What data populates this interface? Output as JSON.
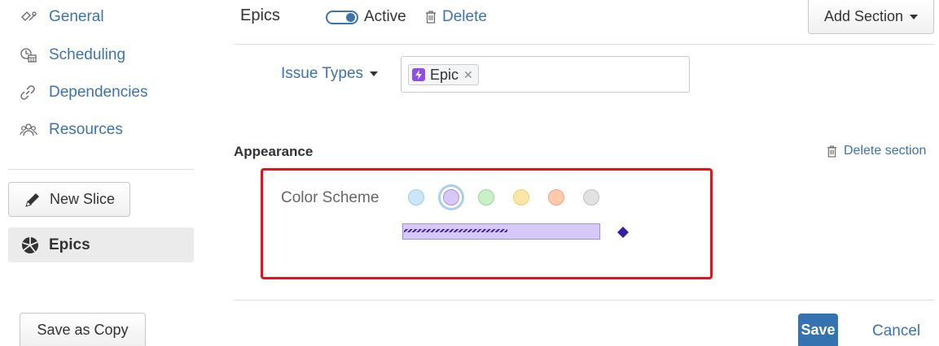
{
  "sidebar": {
    "items": [
      {
        "label": "General",
        "icon": "general-icon"
      },
      {
        "label": "Scheduling",
        "icon": "scheduling-icon"
      },
      {
        "label": "Dependencies",
        "icon": "link-icon"
      },
      {
        "label": "Resources",
        "icon": "people-icon"
      }
    ],
    "new_slice_label": "New Slice",
    "slices": [
      {
        "label": "Epics",
        "icon": "pie-chart-icon",
        "selected": true
      }
    ],
    "save_as_copy_label": "Save as Copy"
  },
  "header": {
    "title": "Epics",
    "active_label": "Active",
    "active": true,
    "delete_label": "Delete",
    "add_section_label": "Add Section"
  },
  "issue_types": {
    "label": "Issue Types",
    "tags": [
      {
        "label": "Epic",
        "icon": "epic-lightning-icon",
        "color": "#904ee2"
      }
    ]
  },
  "appearance": {
    "heading": "Appearance",
    "delete_section_label": "Delete section",
    "color_scheme_label": "Color Scheme",
    "colors": [
      {
        "name": "blue",
        "fill": "#cce5fb",
        "border": "#9fccf2"
      },
      {
        "name": "purple",
        "fill": "#d6c9f7",
        "border": "#a58ce8",
        "selected": true
      },
      {
        "name": "green",
        "fill": "#c9f0c9",
        "border": "#95d895"
      },
      {
        "name": "yellow",
        "fill": "#fbe6a8",
        "border": "#f0cf6e"
      },
      {
        "name": "orange",
        "fill": "#fccbab",
        "border": "#f3a57a"
      },
      {
        "name": "gray",
        "fill": "#e1e1e1",
        "border": "#c2c2c2"
      }
    ],
    "preview": {
      "bar_fill": "#d6c9f7",
      "bar_border": "#a58ce8",
      "hatch_color": "#3e1d9e",
      "progress": 0.53,
      "milestone_color": "#3b1ba8"
    },
    "highlight_color": "#e8101a"
  },
  "footer": {
    "save_label": "Save",
    "cancel_label": "Cancel"
  }
}
